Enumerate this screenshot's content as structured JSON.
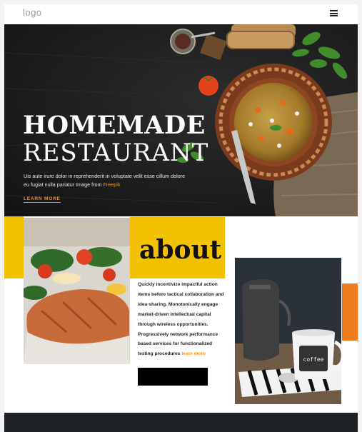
{
  "header": {
    "logo_text": "logo",
    "menu_icon": "hamburger-menu-icon"
  },
  "hero": {
    "title_line1": "HOMEMADE",
    "title_line2": "RESTAURANT",
    "desc_main": "Uis aute irure dolor in reprehenderit in voluptate velit esse cillum dolore eu fugiat nulla pariatur Image from ",
    "desc_credit": "Freepik",
    "learn_more_label": "LEARN MORE"
  },
  "about": {
    "title": "about",
    "body": "Quickly incentivize impactful action items before tactical collaboration and idea-sharing. Monotonically engage market-driven intellectual capital through wireless opportunities. Progressively network performance based services for functionalized testing procedures ",
    "learn_more_label": "learn more",
    "mug_text": "coffee"
  },
  "colors": {
    "accent_orange": "#f39221",
    "accent_yellow": "#f2c200",
    "bar_orange": "#f07c1b",
    "dark": "#1c1c1c"
  }
}
